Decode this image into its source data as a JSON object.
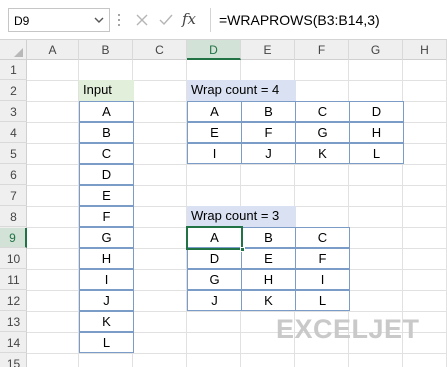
{
  "name_box": {
    "value": "D9"
  },
  "formula_bar": {
    "formula": "=WRAPROWS(B3:B14,3)",
    "insert_function_label": "fx"
  },
  "columns": [
    "A",
    "B",
    "C",
    "D",
    "E",
    "F",
    "G",
    "H"
  ],
  "rows": [
    "1",
    "2",
    "3",
    "4",
    "5",
    "6",
    "7",
    "8",
    "9",
    "10",
    "11",
    "12",
    "13",
    "14",
    "15"
  ],
  "active_cell": {
    "column": "D",
    "row": "9"
  },
  "input_table": {
    "header": "Input",
    "values": [
      "A",
      "B",
      "C",
      "D",
      "E",
      "F",
      "G",
      "H",
      "I",
      "J",
      "K",
      "L"
    ]
  },
  "wrap4": {
    "header": "Wrap count = 4",
    "rows": [
      [
        "A",
        "B",
        "C",
        "D"
      ],
      [
        "E",
        "F",
        "G",
        "H"
      ],
      [
        "I",
        "J",
        "K",
        "L"
      ]
    ]
  },
  "wrap3": {
    "header": "Wrap count = 3",
    "rows": [
      [
        "A",
        "B",
        "C"
      ],
      [
        "D",
        "E",
        "F"
      ],
      [
        "G",
        "H",
        "I"
      ],
      [
        "J",
        "K",
        "L"
      ]
    ]
  },
  "logo": {
    "text": "EXCELJET"
  },
  "colors": {
    "input_header_bg": "#e2efda",
    "wrap_header_bg": "#d9e1f2",
    "cell_border": "#7a9cc6",
    "selection": "#217346",
    "logo": "#c9c9c9"
  },
  "icons": {
    "name_box_dropdown": "chevron-down-icon",
    "cancel": "x-icon",
    "enter": "checkmark-icon",
    "insert_function": "fx-icon"
  }
}
